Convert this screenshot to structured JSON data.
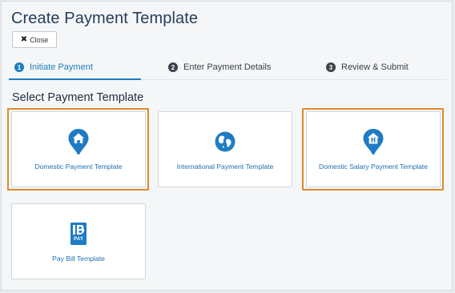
{
  "page": {
    "title": "Create Payment Template",
    "close_label": "Close"
  },
  "steps": [
    {
      "number": "1",
      "label": "Initiate Payment",
      "active": true
    },
    {
      "number": "2",
      "label": "Enter Payment Details",
      "active": false
    },
    {
      "number": "3",
      "label": "Review & Submit",
      "active": false
    }
  ],
  "section_heading": "Select Payment Template",
  "templates": [
    {
      "label": "Domestic Payment Template",
      "icon": "home-pin-icon",
      "highlighted": true
    },
    {
      "label": "International Payment Template",
      "icon": "globe-icon",
      "highlighted": false
    },
    {
      "label": "Domestic Salary Payment Template",
      "icon": "salary-pin-icon",
      "highlighted": true
    },
    {
      "label": "Pay Bill Template",
      "icon": "paybill-icon",
      "icon_text": "PAY",
      "highlighted": false
    }
  ],
  "colors": {
    "accent": "#1e7dc0",
    "highlight_border": "#e08a2c",
    "icon_blue": "#1f7cc4"
  }
}
